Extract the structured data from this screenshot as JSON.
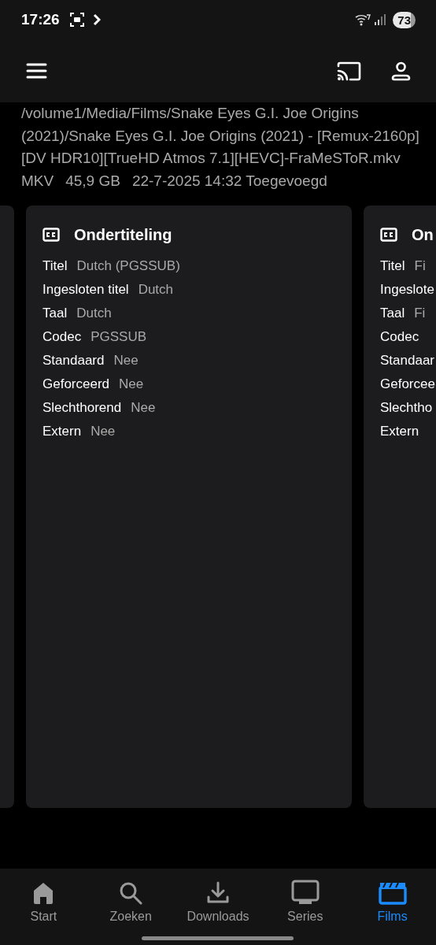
{
  "status_bar": {
    "time": "17:26",
    "battery": "73"
  },
  "file": {
    "path": "/volume1/Media/Films/Snake Eyes G.I. Joe Origins (2021)/Snake Eyes G.I. Joe Origins (2021) - [Remux-2160p][DV HDR10][TrueHD Atmos 7.1][HEVC]-FraMeSToR.mkv",
    "container": "MKV",
    "size": "45,9 GB",
    "added": "22-7-2025 14:32 Toegevoegd"
  },
  "cards": [
    {
      "title": "Ondertiteling",
      "rows": [
        {
          "label": "Titel",
          "value": "Dutch (PGSSUB)"
        },
        {
          "label": "Ingesloten titel",
          "value": "Dutch"
        },
        {
          "label": "Taal",
          "value": "Dutch"
        },
        {
          "label": "Codec",
          "value": "PGSSUB"
        },
        {
          "label": "Standaard",
          "value": "Nee"
        },
        {
          "label": "Geforceerd",
          "value": "Nee"
        },
        {
          "label": "Slechthorend",
          "value": "Nee"
        },
        {
          "label": "Extern",
          "value": "Nee"
        }
      ]
    },
    {
      "title": "On",
      "rows": [
        {
          "label": "Titel",
          "value": "Fi"
        },
        {
          "label": "Ingeslote"
        },
        {
          "label": "Taal",
          "value": "Fi"
        },
        {
          "label": "Codec"
        },
        {
          "label": "Standaar"
        },
        {
          "label": "Geforcee"
        },
        {
          "label": "Slechtho"
        },
        {
          "label": "Extern"
        }
      ]
    }
  ],
  "nav": [
    {
      "label": "Start",
      "kind": "home",
      "selected": false
    },
    {
      "label": "Zoeken",
      "kind": "search",
      "selected": false
    },
    {
      "label": "Downloads",
      "kind": "download",
      "selected": false
    },
    {
      "label": "Series",
      "kind": "tv",
      "selected": false
    },
    {
      "label": "Films",
      "kind": "film",
      "selected": true
    }
  ]
}
